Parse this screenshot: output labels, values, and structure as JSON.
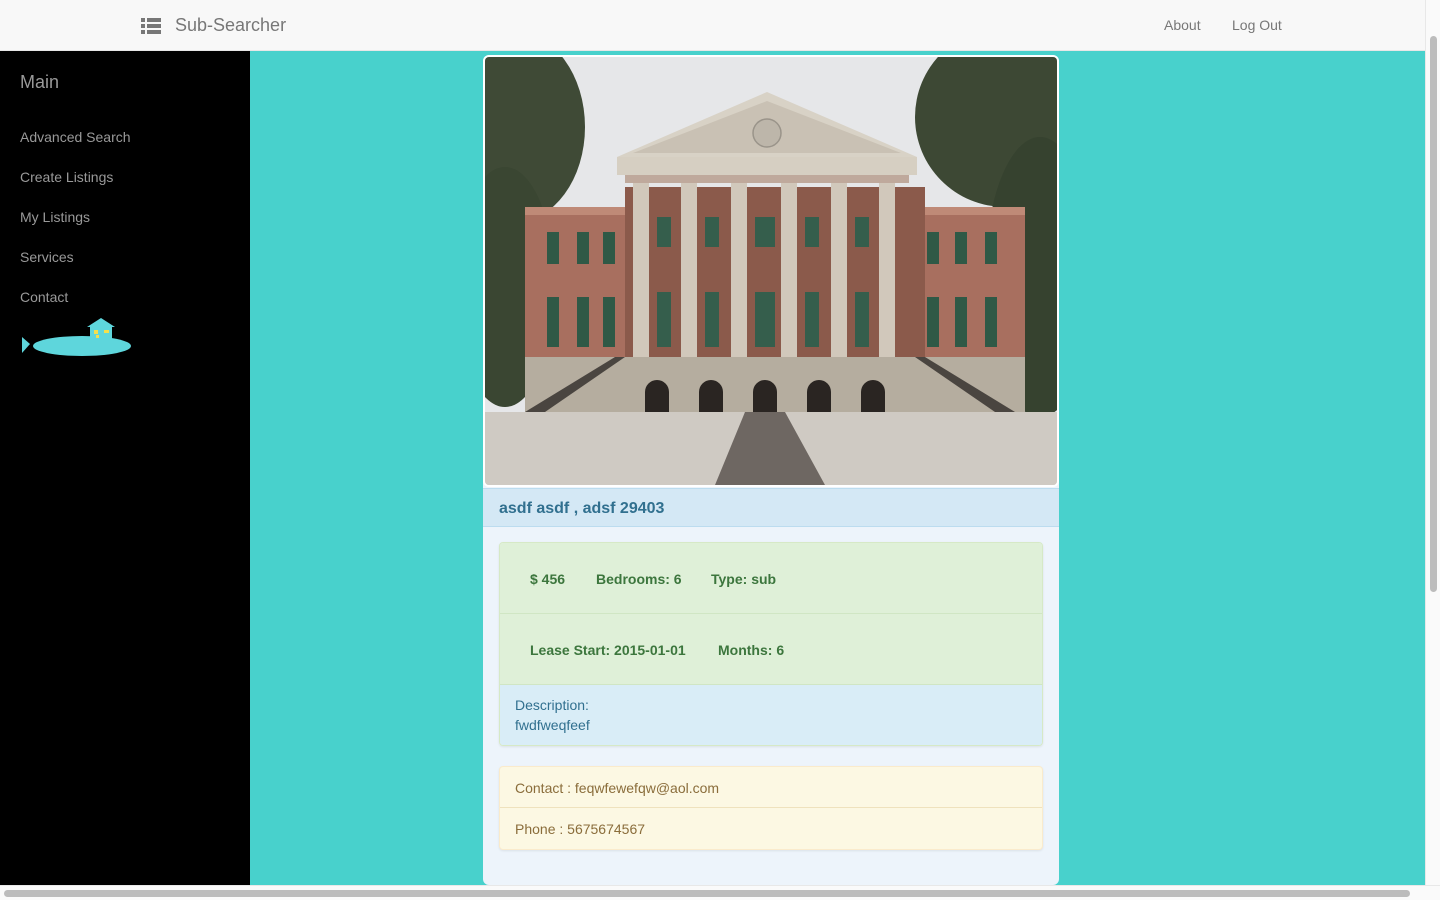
{
  "navbar": {
    "brand": "Sub-Searcher",
    "menu_icon": "list-icon",
    "links": [
      {
        "label": "About"
      },
      {
        "label": "Log Out"
      }
    ]
  },
  "sidebar": {
    "title": "Main",
    "items": [
      {
        "label": "Advanced Search"
      },
      {
        "label": "Create Listings"
      },
      {
        "label": "My Listings"
      },
      {
        "label": "Services"
      },
      {
        "label": "Contact"
      }
    ],
    "logo_icon": "submarine-house-icon"
  },
  "listing": {
    "photo_subject": "building-photo",
    "address": "asdf asdf , adsf 29403",
    "price": "$ 456",
    "bedrooms": "Bedrooms: 6",
    "type": "Type: sub",
    "lease_start": "Lease Start: 2015-01-01",
    "months": "Months: 6",
    "description_label": "Description:",
    "description": "fwdfweqfeef",
    "contact": "Contact : feqwfewefqw@aol.com",
    "phone": "Phone : 5675674567"
  },
  "colors": {
    "page_background": "#48d1cc",
    "sidebar_background": "#000000",
    "navbar_background": "#f8f8f8",
    "accent_submarine": "#5ed6dc"
  }
}
